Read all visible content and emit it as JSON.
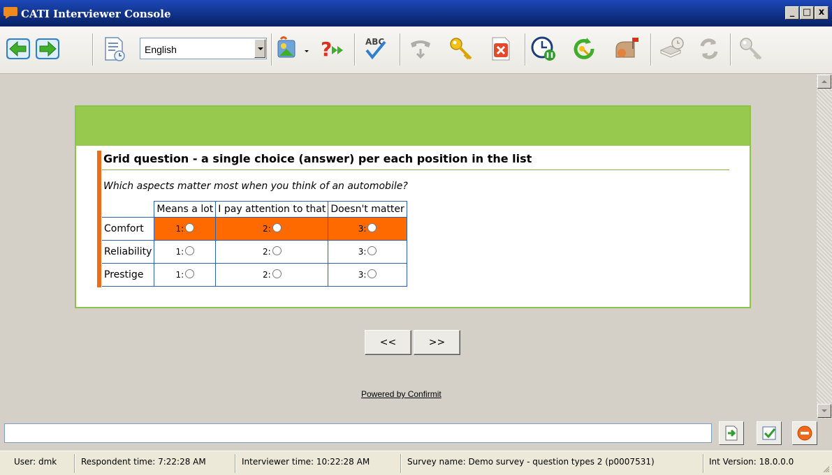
{
  "window": {
    "title": "CATI Interviewer Console",
    "controls": [
      "_",
      "□",
      "x"
    ]
  },
  "toolbar": {
    "language": "English",
    "icons": [
      "back-arrow",
      "forward-arrow",
      "history-page",
      "image-tool",
      "question-skip",
      "spellcheck",
      "phone-hangup",
      "key",
      "cancel",
      "clock-pause",
      "key-refresh",
      "mailbox",
      "book-clock",
      "refresh",
      "key-disabled"
    ]
  },
  "question": {
    "title": "Grid question - a single choice (answer) per each position in the list",
    "text": "Which aspects matter most when you think of an automobile?",
    "columns": [
      "Means a lot",
      "I pay attention to that",
      "Doesn't matter"
    ],
    "rows": [
      {
        "label": "Comfort",
        "selected": true
      },
      {
        "label": "Reliability",
        "selected": false
      },
      {
        "label": "Prestige",
        "selected": false
      }
    ],
    "option_numbers": [
      "1:",
      "2:",
      "3:"
    ]
  },
  "nav": {
    "prev": "<<",
    "next": ">>"
  },
  "footer": {
    "powered": "Powered by Confirmit"
  },
  "status": {
    "user": "User:  dmk",
    "respondent_time": "Respondent time:  7:22:28 AM",
    "interviewer_time": "Interviewer time:  10:22:28 AM",
    "survey_name": "Survey name:  Demo survey - question types 2 (p0007531)",
    "int_version": "Int Version:  18.0.0.0"
  },
  "colors": {
    "header_green": "#96c94e",
    "accent_orange": "#ff6a00",
    "titlebar_blue": "#0a246a"
  }
}
